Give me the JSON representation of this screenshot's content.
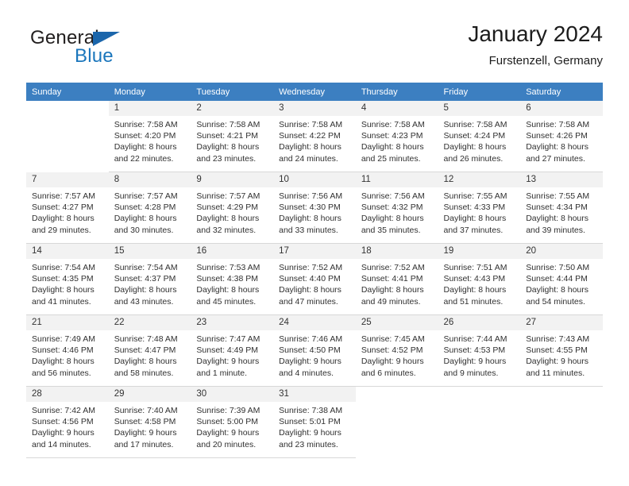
{
  "brand": {
    "name_part1": "General",
    "name_part2": "Blue",
    "flag_icon": "triangle-flag-icon"
  },
  "header": {
    "title": "January 2024",
    "subtitle": "Furstenzell, Germany"
  },
  "colors": {
    "header_row_bg": "#3c7fc1",
    "day_number_bg": "#f2f2f2",
    "brand_blue": "#1b76bc",
    "text": "#303030"
  },
  "weekdays": [
    "Sunday",
    "Monday",
    "Tuesday",
    "Wednesday",
    "Thursday",
    "Friday",
    "Saturday"
  ],
  "weeks": [
    [
      {
        "empty": true
      },
      {
        "day": "1",
        "sunrise": "Sunrise: 7:58 AM",
        "sunset": "Sunset: 4:20 PM",
        "daylight1": "Daylight: 8 hours",
        "daylight2": "and 22 minutes."
      },
      {
        "day": "2",
        "sunrise": "Sunrise: 7:58 AM",
        "sunset": "Sunset: 4:21 PM",
        "daylight1": "Daylight: 8 hours",
        "daylight2": "and 23 minutes."
      },
      {
        "day": "3",
        "sunrise": "Sunrise: 7:58 AM",
        "sunset": "Sunset: 4:22 PM",
        "daylight1": "Daylight: 8 hours",
        "daylight2": "and 24 minutes."
      },
      {
        "day": "4",
        "sunrise": "Sunrise: 7:58 AM",
        "sunset": "Sunset: 4:23 PM",
        "daylight1": "Daylight: 8 hours",
        "daylight2": "and 25 minutes."
      },
      {
        "day": "5",
        "sunrise": "Sunrise: 7:58 AM",
        "sunset": "Sunset: 4:24 PM",
        "daylight1": "Daylight: 8 hours",
        "daylight2": "and 26 minutes."
      },
      {
        "day": "6",
        "sunrise": "Sunrise: 7:58 AM",
        "sunset": "Sunset: 4:26 PM",
        "daylight1": "Daylight: 8 hours",
        "daylight2": "and 27 minutes."
      }
    ],
    [
      {
        "day": "7",
        "sunrise": "Sunrise: 7:57 AM",
        "sunset": "Sunset: 4:27 PM",
        "daylight1": "Daylight: 8 hours",
        "daylight2": "and 29 minutes."
      },
      {
        "day": "8",
        "sunrise": "Sunrise: 7:57 AM",
        "sunset": "Sunset: 4:28 PM",
        "daylight1": "Daylight: 8 hours",
        "daylight2": "and 30 minutes."
      },
      {
        "day": "9",
        "sunrise": "Sunrise: 7:57 AM",
        "sunset": "Sunset: 4:29 PM",
        "daylight1": "Daylight: 8 hours",
        "daylight2": "and 32 minutes."
      },
      {
        "day": "10",
        "sunrise": "Sunrise: 7:56 AM",
        "sunset": "Sunset: 4:30 PM",
        "daylight1": "Daylight: 8 hours",
        "daylight2": "and 33 minutes."
      },
      {
        "day": "11",
        "sunrise": "Sunrise: 7:56 AM",
        "sunset": "Sunset: 4:32 PM",
        "daylight1": "Daylight: 8 hours",
        "daylight2": "and 35 minutes."
      },
      {
        "day": "12",
        "sunrise": "Sunrise: 7:55 AM",
        "sunset": "Sunset: 4:33 PM",
        "daylight1": "Daylight: 8 hours",
        "daylight2": "and 37 minutes."
      },
      {
        "day": "13",
        "sunrise": "Sunrise: 7:55 AM",
        "sunset": "Sunset: 4:34 PM",
        "daylight1": "Daylight: 8 hours",
        "daylight2": "and 39 minutes."
      }
    ],
    [
      {
        "day": "14",
        "sunrise": "Sunrise: 7:54 AM",
        "sunset": "Sunset: 4:35 PM",
        "daylight1": "Daylight: 8 hours",
        "daylight2": "and 41 minutes."
      },
      {
        "day": "15",
        "sunrise": "Sunrise: 7:54 AM",
        "sunset": "Sunset: 4:37 PM",
        "daylight1": "Daylight: 8 hours",
        "daylight2": "and 43 minutes."
      },
      {
        "day": "16",
        "sunrise": "Sunrise: 7:53 AM",
        "sunset": "Sunset: 4:38 PM",
        "daylight1": "Daylight: 8 hours",
        "daylight2": "and 45 minutes."
      },
      {
        "day": "17",
        "sunrise": "Sunrise: 7:52 AM",
        "sunset": "Sunset: 4:40 PM",
        "daylight1": "Daylight: 8 hours",
        "daylight2": "and 47 minutes."
      },
      {
        "day": "18",
        "sunrise": "Sunrise: 7:52 AM",
        "sunset": "Sunset: 4:41 PM",
        "daylight1": "Daylight: 8 hours",
        "daylight2": "and 49 minutes."
      },
      {
        "day": "19",
        "sunrise": "Sunrise: 7:51 AM",
        "sunset": "Sunset: 4:43 PM",
        "daylight1": "Daylight: 8 hours",
        "daylight2": "and 51 minutes."
      },
      {
        "day": "20",
        "sunrise": "Sunrise: 7:50 AM",
        "sunset": "Sunset: 4:44 PM",
        "daylight1": "Daylight: 8 hours",
        "daylight2": "and 54 minutes."
      }
    ],
    [
      {
        "day": "21",
        "sunrise": "Sunrise: 7:49 AM",
        "sunset": "Sunset: 4:46 PM",
        "daylight1": "Daylight: 8 hours",
        "daylight2": "and 56 minutes."
      },
      {
        "day": "22",
        "sunrise": "Sunrise: 7:48 AM",
        "sunset": "Sunset: 4:47 PM",
        "daylight1": "Daylight: 8 hours",
        "daylight2": "and 58 minutes."
      },
      {
        "day": "23",
        "sunrise": "Sunrise: 7:47 AM",
        "sunset": "Sunset: 4:49 PM",
        "daylight1": "Daylight: 9 hours",
        "daylight2": "and 1 minute."
      },
      {
        "day": "24",
        "sunrise": "Sunrise: 7:46 AM",
        "sunset": "Sunset: 4:50 PM",
        "daylight1": "Daylight: 9 hours",
        "daylight2": "and 4 minutes."
      },
      {
        "day": "25",
        "sunrise": "Sunrise: 7:45 AM",
        "sunset": "Sunset: 4:52 PM",
        "daylight1": "Daylight: 9 hours",
        "daylight2": "and 6 minutes."
      },
      {
        "day": "26",
        "sunrise": "Sunrise: 7:44 AM",
        "sunset": "Sunset: 4:53 PM",
        "daylight1": "Daylight: 9 hours",
        "daylight2": "and 9 minutes."
      },
      {
        "day": "27",
        "sunrise": "Sunrise: 7:43 AM",
        "sunset": "Sunset: 4:55 PM",
        "daylight1": "Daylight: 9 hours",
        "daylight2": "and 11 minutes."
      }
    ],
    [
      {
        "day": "28",
        "sunrise": "Sunrise: 7:42 AM",
        "sunset": "Sunset: 4:56 PM",
        "daylight1": "Daylight: 9 hours",
        "daylight2": "and 14 minutes."
      },
      {
        "day": "29",
        "sunrise": "Sunrise: 7:40 AM",
        "sunset": "Sunset: 4:58 PM",
        "daylight1": "Daylight: 9 hours",
        "daylight2": "and 17 minutes."
      },
      {
        "day": "30",
        "sunrise": "Sunrise: 7:39 AM",
        "sunset": "Sunset: 5:00 PM",
        "daylight1": "Daylight: 9 hours",
        "daylight2": "and 20 minutes."
      },
      {
        "day": "31",
        "sunrise": "Sunrise: 7:38 AM",
        "sunset": "Sunset: 5:01 PM",
        "daylight1": "Daylight: 9 hours",
        "daylight2": "and 23 minutes."
      },
      {
        "empty": true
      },
      {
        "empty": true
      },
      {
        "empty": true
      }
    ]
  ]
}
